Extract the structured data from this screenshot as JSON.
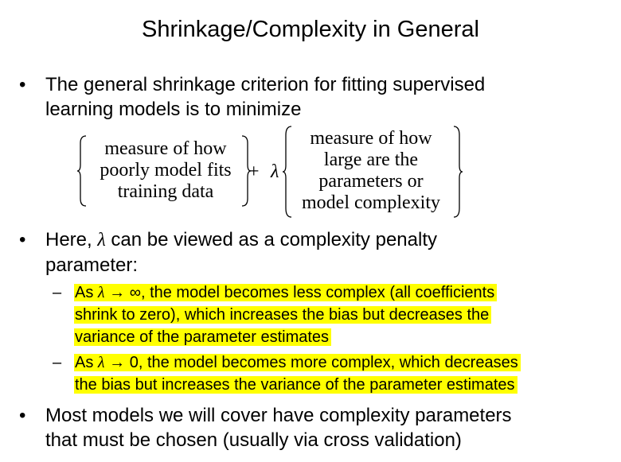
{
  "slide": {
    "title": "Shrinkage/Complexity in General",
    "bullet_symbol": "•",
    "dash_symbol": "–",
    "bullet1": {
      "line1": "The general shrinkage criterion for fitting supervised",
      "line2": "learning models is to minimize"
    },
    "formula": {
      "left": [
        "measure of how",
        "poorly model fits",
        "training data"
      ],
      "plus": "+",
      "lambda": "λ",
      "right": [
        "measure of how",
        "large are the",
        "parameters or",
        "model complexity"
      ]
    },
    "bullet2": {
      "pre": "Here, ",
      "lambda": "λ",
      "post": " can be viewed as a complexity penalty",
      "line2": "parameter:"
    },
    "sub1": {
      "pre": "As ",
      "lambda": "λ",
      "arrow_inf": " → ∞",
      "line1_rest": ", the model becomes less complex (all coefficients",
      "line2": "shrink to zero), which increases the bias but decreases the",
      "line3": "variance of the parameter estimates"
    },
    "sub2": {
      "pre": "As ",
      "lambda": "λ",
      "arrow_zero": " → 0",
      "line1_rest": ", the model becomes more complex, which decreases",
      "line2": "the bias but increases the variance of the parameter estimates"
    },
    "bullet3": {
      "line1": "Most models we will cover have complexity parameters",
      "line2": "that must be chosen (usually via cross validation)"
    },
    "highlight_color": "#ffff00"
  }
}
